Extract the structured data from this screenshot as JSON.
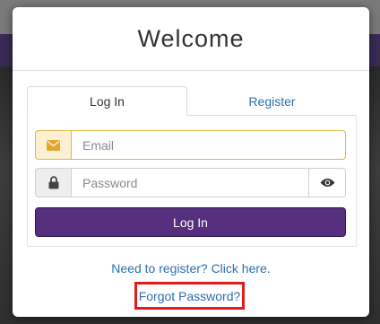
{
  "modal": {
    "title": "Welcome"
  },
  "tabs": [
    {
      "label": "Log In",
      "active": true
    },
    {
      "label": "Register",
      "active": false
    }
  ],
  "form": {
    "email_placeholder": "Email",
    "password_placeholder": "Password",
    "submit_label": "Log In"
  },
  "links": {
    "register": "Need to register? Click here.",
    "forgot": "Forgot Password?"
  },
  "icons": {
    "email": "envelope-icon",
    "password": "lock-icon",
    "reveal": "eye-icon"
  },
  "colors": {
    "accent": "#56307f",
    "link": "#2a6fb1",
    "email_highlight": "#e2b64a",
    "annotation": "#e21c1c"
  }
}
